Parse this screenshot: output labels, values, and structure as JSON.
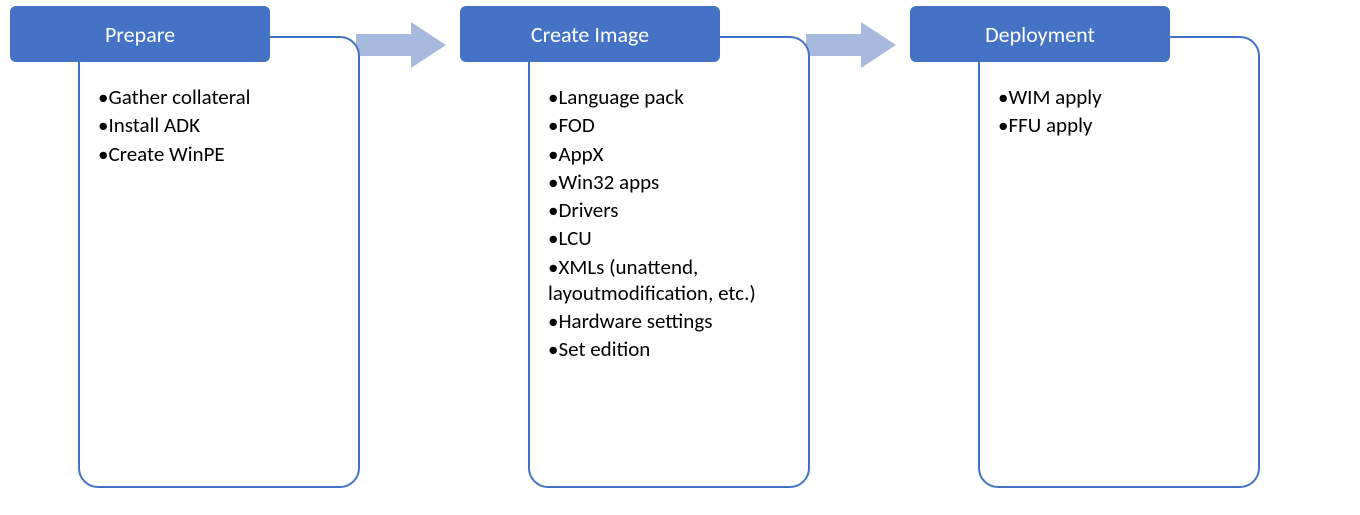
{
  "diagram": {
    "type": "process-flow",
    "stages": [
      {
        "title": "Prepare",
        "items": [
          "Gather collateral",
          "Install ADK",
          "Create WinPE"
        ]
      },
      {
        "title": "Create Image",
        "items": [
          "Language pack",
          "FOD",
          "AppX",
          "Win32 apps",
          "Drivers",
          "LCU",
          "XMLs (unattend, layoutmodification, etc.)",
          "Hardware settings",
          "Set edition"
        ]
      },
      {
        "title": "Deployment",
        "items": [
          "WIM apply",
          "FFU apply"
        ]
      }
    ],
    "colors": {
      "header_fill": "#4472C4",
      "header_text": "#FFFFFF",
      "body_border": "#4472C4",
      "arrow_fill": "#A8B9DE"
    }
  }
}
